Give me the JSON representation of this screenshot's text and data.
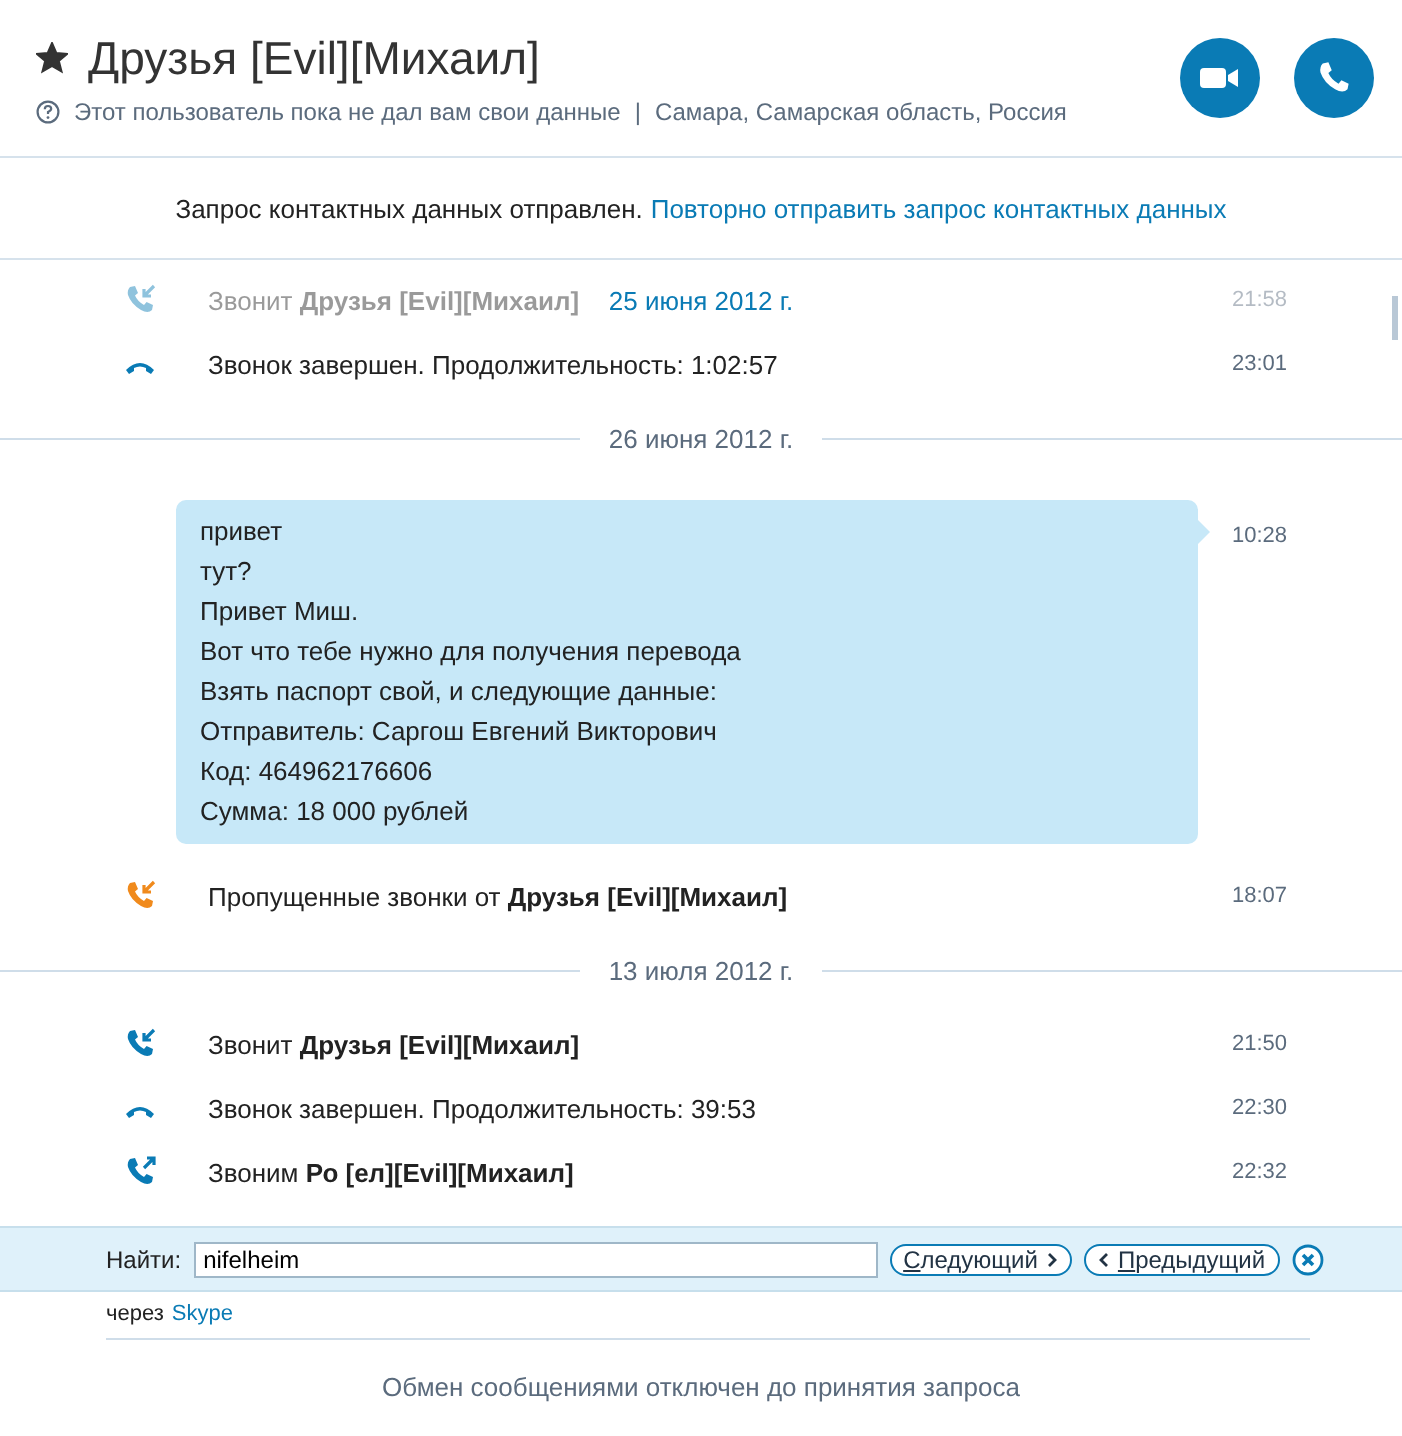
{
  "header": {
    "favorite": true,
    "name": "Друзья [Evil][Михаил]",
    "status": "Этот пользователь пока не дал вам свои данные",
    "separator": "|",
    "location": "Самара, Самарская область, Россия"
  },
  "notice": {
    "text": "Запрос контактных данных отправлен.",
    "link": "Повторно отправить запрос контактных данных"
  },
  "sticky_date": "25 июня 2012 г.",
  "events": [
    {
      "kind": "incoming",
      "text": "Звонит **Друзья [Evil][Михаил]**",
      "time": "21:58",
      "faded": true
    },
    {
      "kind": "ended",
      "text": "Звонок завершен. Продолжительность: 1:02:57",
      "time": "23:01",
      "faded": false
    },
    {
      "kind": "date",
      "text": "26 июня 2012 г."
    },
    {
      "kind": "message",
      "lines": [
        "привет",
        "тут?",
        "Привет Миш.",
        "Вот что тебе нужно для получения перевода",
        "Взять паспорт свой, и следующие данные:",
        "Отправитель: Саргош Евгений Викторович",
        "Код: 464962176606",
        "Сумма: 18 000 рублей"
      ],
      "time": "10:28"
    },
    {
      "kind": "missed",
      "text": "Пропущенные звонки от **Друзья [Evil][Михаил]**",
      "time": "18:07",
      "faded": false
    },
    {
      "kind": "date",
      "text": "13 июля 2012 г."
    },
    {
      "kind": "incoming",
      "text": "Звонит **Друзья [Evil][Михаил]**",
      "time": "21:50",
      "faded": false
    },
    {
      "kind": "ended",
      "text": "Звонок завершен. Продолжительность: 39:53",
      "time": "22:30",
      "faded": false
    },
    {
      "kind": "outgoing",
      "text": "Звоним **Ро [ел][Evil][Михаил]**",
      "time": "22:32",
      "faded": false
    }
  ],
  "find_bar": {
    "label": "Найти:",
    "value": "nifelheim",
    "next": "Следующий",
    "previous": "Предыдущий"
  },
  "footer": {
    "via": "через",
    "via_link": "Skype",
    "message": "Обмен сообщениями отключен до принятия запроса"
  }
}
